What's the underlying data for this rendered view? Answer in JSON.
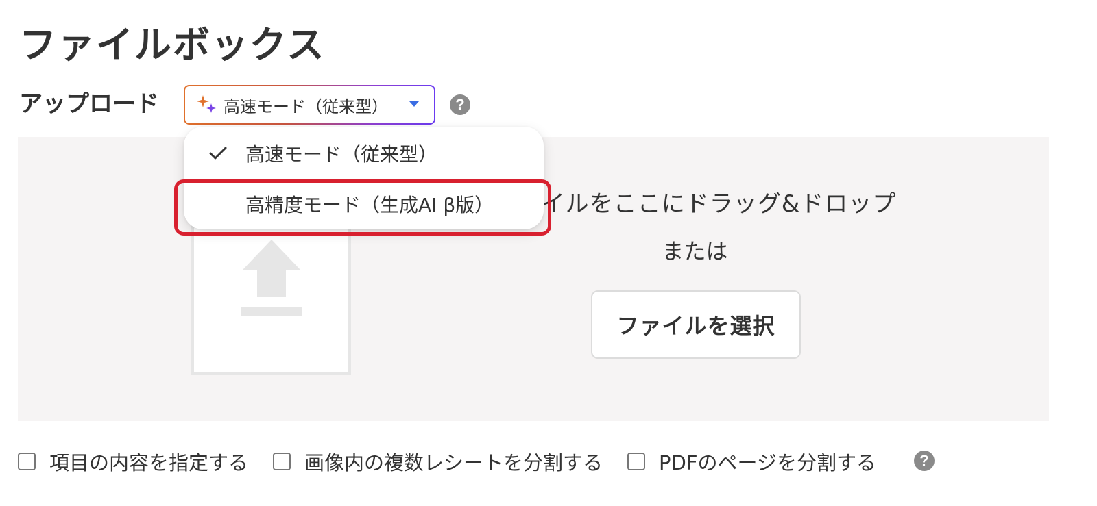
{
  "page": {
    "title": "ファイルボックス"
  },
  "upload": {
    "label": "アップロード",
    "mode_select": {
      "selected_value": "高速モード（従来型）",
      "accent_gradient": [
        "#e0712c",
        "#6b3bf0"
      ],
      "caret_color": "#3b6de3"
    },
    "help_icon": "?"
  },
  "dropdown": {
    "items": [
      {
        "label": "高速モード（従来型）",
        "checked": true
      },
      {
        "label": "高精度モード（生成AI β版）",
        "checked": false,
        "highlighted": true
      }
    ],
    "highlight_color": "#d8202f"
  },
  "dropzone": {
    "drop_text": "ファイルをここにドラッグ&ドロップ",
    "or_text": "または",
    "select_button_label": "ファイルを選択"
  },
  "options": [
    {
      "label": "項目の内容を指定する",
      "checked": false
    },
    {
      "label": "画像内の複数レシートを分割する",
      "checked": false
    },
    {
      "label": "PDFのページを分割する",
      "checked": false
    }
  ],
  "options_help_icon": "?"
}
